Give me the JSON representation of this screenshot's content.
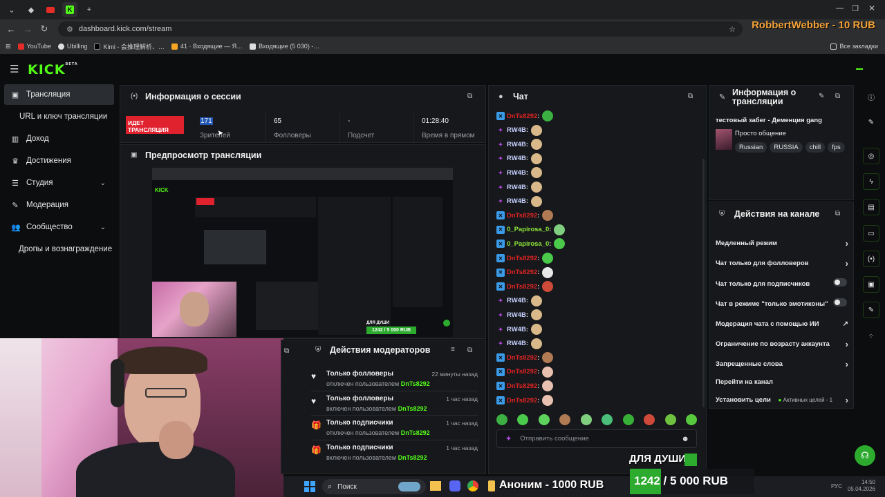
{
  "browser": {
    "url": "dashboard.kick.com/stream",
    "bookmarks": [
      "YouTube",
      "Ubilling",
      "Kimi - 会推理解析、…",
      "41 · Входящие — Я…",
      "Входящие (5 030) -…"
    ],
    "all_bookmarks": "Все закладки",
    "overlay_donation": "RobbertWebber - 10 RUB"
  },
  "header": {
    "logo": "KICK",
    "logo_beta": "BETA"
  },
  "sidebar": {
    "items": [
      {
        "label": "Трансляция",
        "icon": "broadcast-icon"
      },
      {
        "label": "URL и ключ трансляции",
        "icon": ""
      },
      {
        "label": "Доход",
        "icon": "chart-icon"
      },
      {
        "label": "Достижения",
        "icon": "trophy-icon"
      },
      {
        "label": "Студия",
        "icon": "studio-icon"
      },
      {
        "label": "Модерация",
        "icon": "wrench-icon"
      },
      {
        "label": "Сообщество",
        "icon": "users-icon"
      },
      {
        "label": "Дропы и вознаграждение",
        "icon": ""
      }
    ]
  },
  "session": {
    "title": "Информация о сессии",
    "live_badge": "ИДЕТ ТРАНСЛЯЦИЯ",
    "stats": [
      {
        "value": "171",
        "label": "Зрителей"
      },
      {
        "value": "65",
        "label": "Фолловеры"
      },
      {
        "value": "-",
        "label": "Подсчет"
      },
      {
        "value": "01:28:40",
        "label": "Время в прямом"
      }
    ]
  },
  "preview": {
    "title": "Предпросмотр трансляции",
    "inner_overlay": "1242 / 5 000 RUB",
    "inner_label": "ДЛЯ ДУШИ"
  },
  "mod_actions": {
    "title": "Действия модераторов",
    "items": [
      {
        "title": "Только фолловеры",
        "sub": "отключен пользователем",
        "user": "DnTs8292",
        "time": "22 минуты назад",
        "icon": "heart-icon"
      },
      {
        "title": "Только фолловеры",
        "sub": "включен пользователем",
        "user": "DnTs8292",
        "time": "1 час назад",
        "icon": "heart-icon"
      },
      {
        "title": "Только подписчики",
        "sub": "отключен пользователем",
        "user": "DnTs8292",
        "time": "1 час назад",
        "icon": "gift-icon"
      },
      {
        "title": "Только подписчики",
        "sub": "включен пользователем",
        "user": "DnTs8292",
        "time": "1 час назад",
        "icon": "gift-icon"
      }
    ]
  },
  "chat": {
    "title": "Чат",
    "placeholder": "Отправить сообщение",
    "messages": [
      {
        "user": "DnTs8292",
        "color": "#e02424",
        "badge": "#3b9be8"
      },
      {
        "user": "RW4B",
        "color": "#c7d0ff",
        "badge": "#b84ce8"
      },
      {
        "user": "RW4B",
        "color": "#c7d0ff",
        "badge": "#b84ce8"
      },
      {
        "user": "RW4B",
        "color": "#c7d0ff",
        "badge": "#b84ce8"
      },
      {
        "user": "RW4B",
        "color": "#c7d0ff",
        "badge": "#b84ce8"
      },
      {
        "user": "RW4B",
        "color": "#c7d0ff",
        "badge": "#b84ce8"
      },
      {
        "user": "RW4B",
        "color": "#c7d0ff",
        "badge": "#b84ce8"
      },
      {
        "user": "DnTs8292",
        "color": "#e02424",
        "badge": "#3b9be8"
      },
      {
        "user": "0_Papirosa_0",
        "color": "#8fe83b",
        "badge": "#3b9be8"
      },
      {
        "user": "0_Papirosa_0",
        "color": "#8fe83b",
        "badge": "#3b9be8"
      },
      {
        "user": "DnTs8292",
        "color": "#e02424",
        "badge": "#3b9be8"
      },
      {
        "user": "DnTs8292",
        "color": "#e02424",
        "badge": "#3b9be8"
      },
      {
        "user": "DnTs8292",
        "color": "#e02424",
        "badge": "#3b9be8"
      },
      {
        "user": "RW4B",
        "color": "#c7d0ff",
        "badge": "#b84ce8"
      },
      {
        "user": "RW4B",
        "color": "#c7d0ff",
        "badge": "#b84ce8"
      },
      {
        "user": "RW4B",
        "color": "#c7d0ff",
        "badge": "#b84ce8"
      },
      {
        "user": "RW4B",
        "color": "#c7d0ff",
        "badge": "#b84ce8"
      },
      {
        "user": "DnTs8292",
        "color": "#e02424",
        "badge": "#3b9be8"
      },
      {
        "user": "DnTs8292",
        "color": "#e02424",
        "badge": "#3b9be8"
      },
      {
        "user": "DnTs8292",
        "color": "#e02424",
        "badge": "#3b9be8"
      },
      {
        "user": "DnTs8292",
        "color": "#e02424",
        "badge": "#3b9be8"
      }
    ]
  },
  "stream_info": {
    "title": "Информация о трансляции",
    "stream_title": "тестовый забег - Деменция gang",
    "category": "Просто общение",
    "tags": [
      "Russian",
      "RUSSIA",
      "chill",
      "fps"
    ]
  },
  "channel_actions": {
    "title": "Действия на канале",
    "items": [
      {
        "label": "Медленный режим",
        "control": "chevron"
      },
      {
        "label": "Чат только для фолловеров",
        "control": "chevron"
      },
      {
        "label": "Чат только для подписчиков",
        "control": "toggle"
      },
      {
        "label": "Чат в режиме \"только эмотиконы\"",
        "control": "toggle"
      },
      {
        "label": "Модерация чата с помощью ИИ",
        "control": "external"
      },
      {
        "label": "Ограничение по возрасту аккаунта",
        "control": "chevron"
      },
      {
        "label": "Запрещенные слова",
        "control": "chevron"
      },
      {
        "label": "Перейти на канал",
        "control": "none"
      },
      {
        "label": "Установить цели",
        "control": "chevron",
        "extra": "Активных целей - 1"
      }
    ]
  },
  "overlay": {
    "goal_label": "ДЛЯ ДУШИ",
    "goal_progress": "1242 / 5 000 RUB",
    "goal_fraction": 0.248,
    "donation_bottom": "Аноним - 1000 RUB"
  },
  "taskbar": {
    "search": "Поиск",
    "lang": "РУС",
    "time": "14:50",
    "date": "05.04.2026"
  },
  "colors": {
    "accent": "#53fc18",
    "live": "#e0222f",
    "panel": "#16181b",
    "bg": "#0b0d0e"
  }
}
